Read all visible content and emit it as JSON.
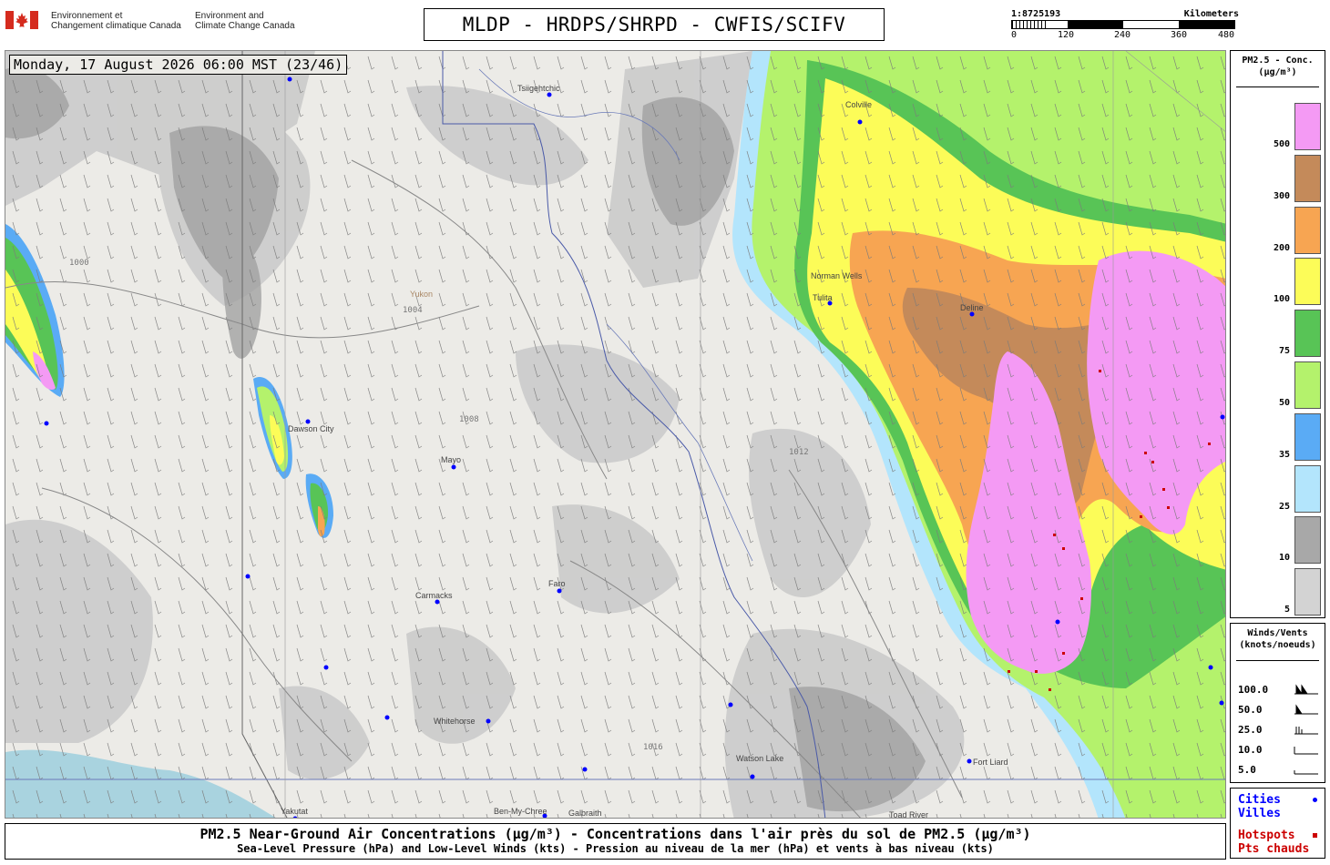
{
  "header": {
    "dept_fr": "Environnement et\nChangement climatique Canada",
    "dept_en": "Environment and\nClimate Change Canada",
    "title": "MLDP - HRDPS/SHRPD - CWFIS/SCIFV",
    "scale_ratio": "1:8725193",
    "scale_unit": "Kilometers",
    "scale_ticks": [
      "0",
      "120",
      "240",
      "360",
      "480"
    ]
  },
  "map": {
    "datetime": "Monday, 17 August 2026 06:00 MST (23/46)",
    "places": [
      {
        "name": "Tsiigehtchic",
        "type": "city"
      },
      {
        "name": "Colville",
        "type": "city"
      },
      {
        "name": "Norman Wells",
        "type": "city"
      },
      {
        "name": "Tulita",
        "type": "city"
      },
      {
        "name": "Deline",
        "type": "city"
      },
      {
        "name": "Dawson City",
        "type": "city"
      },
      {
        "name": "Mayo",
        "type": "city"
      },
      {
        "name": "Carmacks",
        "type": "city"
      },
      {
        "name": "Faro",
        "type": "city"
      },
      {
        "name": "Whitehorse",
        "type": "city"
      },
      {
        "name": "Watson Lake",
        "type": "city"
      },
      {
        "name": "Fort Liard",
        "type": "city"
      },
      {
        "name": "Yakutat",
        "type": "city"
      },
      {
        "name": "Ben-My-Chree",
        "type": "city"
      },
      {
        "name": "Galbraith",
        "type": "city"
      },
      {
        "name": "Toad River",
        "type": "city"
      },
      {
        "name": "Yukon",
        "type": "region"
      }
    ],
    "isobar_labels": [
      "1000",
      "1004",
      "1008",
      "1012",
      "1016"
    ],
    "colors": {
      "land": "#ecebe7",
      "ocean": "#a9d3df",
      "pm_5": "#d3d3d3",
      "pm_10": "#a8a8a8",
      "pm_25": "#b3e5fc",
      "pm_35": "#5aabf5",
      "pm_50": "#b4f26c",
      "pm_75": "#58c456",
      "pm_100": "#fcfc58",
      "pm_200": "#f7a552",
      "pm_300": "#c48a5a",
      "pm_500": "#f49af4"
    }
  },
  "legend_pm": {
    "title": "PM2.5 - Conc.\n(µg/m³)",
    "levels": [
      {
        "value": "500",
        "color": "#f49af4"
      },
      {
        "value": "300",
        "color": "#c48a5a"
      },
      {
        "value": "200",
        "color": "#f7a552"
      },
      {
        "value": "100",
        "color": "#fcfc58"
      },
      {
        "value": "75",
        "color": "#58c456"
      },
      {
        "value": "50",
        "color": "#b4f26c"
      },
      {
        "value": "35",
        "color": "#5aabf5"
      },
      {
        "value": "25",
        "color": "#b3e5fc"
      },
      {
        "value": "10",
        "color": "#a8a8a8"
      },
      {
        "value": "5",
        "color": "#d3d3d3"
      }
    ]
  },
  "legend_wind": {
    "title": "Winds/Vents\n(knots/noeuds)",
    "rows": [
      "100.0",
      "50.0",
      "25.0",
      "10.0",
      "5.0"
    ]
  },
  "legend_points": {
    "cities_en": "Cities",
    "cities_fr": "Villes",
    "hotspots_en": "Hotspots",
    "hotspots_fr": "Pts chauds"
  },
  "caption": {
    "line1": "PM2.5 Near-Ground Air Concentrations (µg/m³) - Concentrations dans l'air près du sol de PM2.5 (µg/m³)",
    "line2": "Sea-Level Pressure (hPa) and Low-Level Winds (kts) - Pression au niveau de la mer (hPa) et vents à bas niveau (kts)"
  }
}
